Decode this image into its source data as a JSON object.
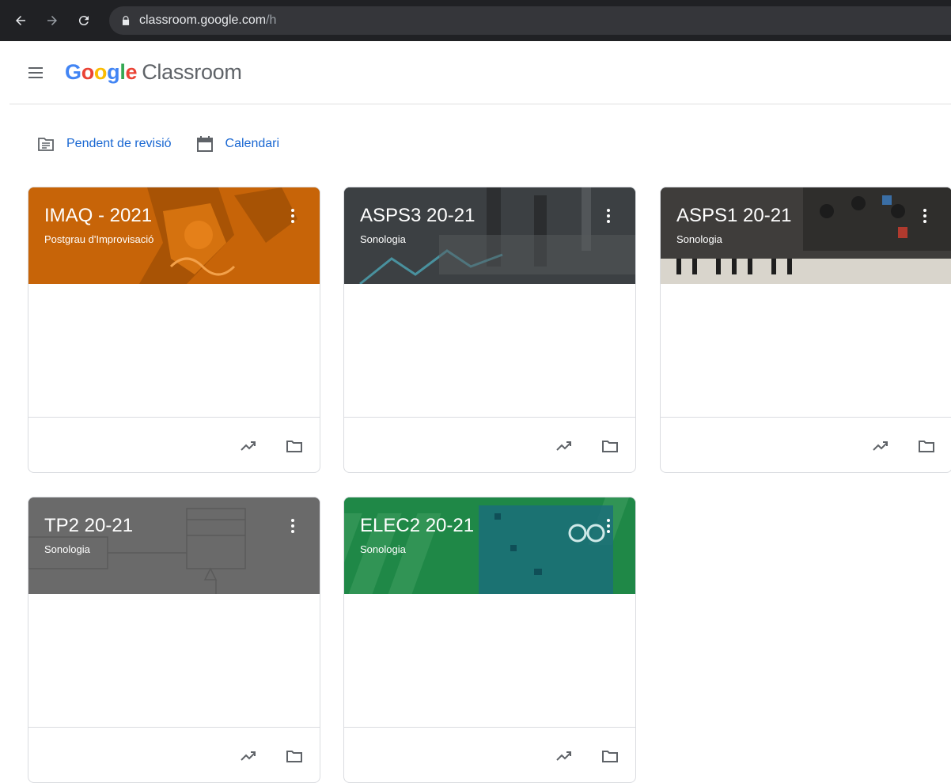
{
  "browser": {
    "url_domain": "classroom.google.com",
    "url_path": "/h",
    "bar_color": "#202124"
  },
  "header": {
    "logo_letters": [
      "G",
      "o",
      "o",
      "g",
      "l",
      "e"
    ],
    "product_name": "Classroom"
  },
  "quick_links": {
    "review_label": "Pendent de revisió",
    "calendar_label": "Calendari"
  },
  "colors": {
    "accent_blue": "#1967d2",
    "card_1_banner": "#c76408",
    "card_2_banner": "#3c4043",
    "card_3_banner": "#3f3d3b",
    "card_4_banner": "#6a6a6a",
    "card_5_banner": "#1f8847"
  },
  "classes": [
    {
      "name": "IMAQ - 2021",
      "section": "Postgrau d'Improvisació"
    },
    {
      "name": "ASPS3 20-21",
      "section": "Sonologia"
    },
    {
      "name": "ASPS1 20-21",
      "section": "Sonologia"
    },
    {
      "name": "TP2 20-21",
      "section": "Sonologia"
    },
    {
      "name": "ELEC2 20-21",
      "section": "Sonologia"
    }
  ],
  "icons": {
    "back": "arrow-left-icon",
    "forward": "arrow-right-icon",
    "reload": "reload-icon",
    "lock": "lock-icon",
    "menu": "hamburger-icon",
    "review": "assignment-icon",
    "calendar": "calendar-icon",
    "class_menu": "more-vert-icon",
    "gradebook": "trending-up-icon",
    "folder": "folder-icon"
  }
}
